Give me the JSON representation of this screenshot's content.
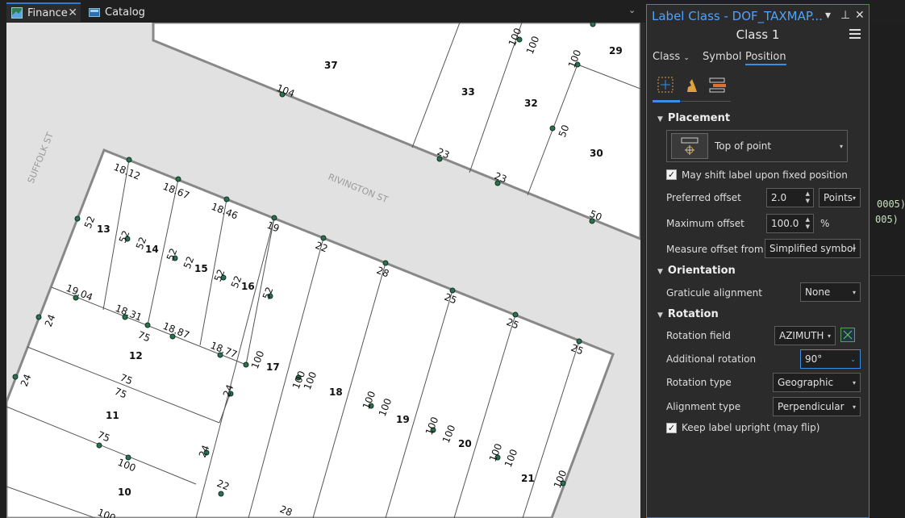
{
  "tabs": {
    "finance": "Finance",
    "catalog": "Catalog"
  },
  "panel": {
    "title": "Label Class - DOF_TAXMAP....",
    "class_name": "Class 1",
    "tabs": {
      "class": "Class",
      "symbol": "Symbol",
      "position": "Position"
    },
    "placement": {
      "header": "Placement",
      "type": "Top of point",
      "shift_label": "May shift label upon fixed position",
      "preferred_offset_label": "Preferred offset",
      "preferred_offset_value": "2.0",
      "offset_unit": "Points",
      "max_offset_label": "Maximum offset",
      "max_offset_value": "100.0",
      "max_offset_unit": "%",
      "measure_from_label": "Measure offset from",
      "measure_from_value": "Simplified symbol"
    },
    "orientation": {
      "header": "Orientation",
      "graticule_label": "Graticule alignment",
      "graticule_value": "None"
    },
    "rotation": {
      "header": "Rotation",
      "field_label": "Rotation field",
      "field_value": "AZIMUTH",
      "additional_label": "Additional rotation",
      "additional_value": "90°",
      "type_label": "Rotation type",
      "type_value": "Geographic",
      "alignment_label": "Alignment type",
      "alignment_value": "Perpendicular",
      "upright_label": "Keep label upright (may flip)"
    }
  },
  "side_code": [
    "0005)",
    "005)"
  ],
  "map": {
    "streets": [
      "SUFFOLK ST",
      "RIVINGTON ST"
    ],
    "lots": [
      "37",
      "33",
      "32",
      "29",
      "30",
      "13",
      "14",
      "15",
      "16",
      "12",
      "17",
      "18",
      "19",
      "20",
      "21",
      "11",
      "10"
    ],
    "dims": [
      "100",
      "100",
      "100",
      "104",
      "23",
      "23",
      "50",
      "50",
      "18.12",
      "18.67",
      "18.46",
      "19",
      "22",
      "28",
      "25",
      "25",
      "25",
      "52",
      "52",
      "52",
      "52",
      "52",
      "52",
      "52",
      "52",
      "19.04",
      "18.31",
      "18.87",
      "18.77",
      "75",
      "24",
      "24",
      "100",
      "100",
      "100",
      "100",
      "100",
      "100",
      "100",
      "100",
      "75",
      "75",
      "24",
      "24",
      "75",
      "100",
      "22",
      "28",
      "100",
      "100",
      "100"
    ]
  },
  "colors": {
    "accent": "#3a8ee6",
    "title": "#4da3ff",
    "vertex": "#2e6f52"
  }
}
